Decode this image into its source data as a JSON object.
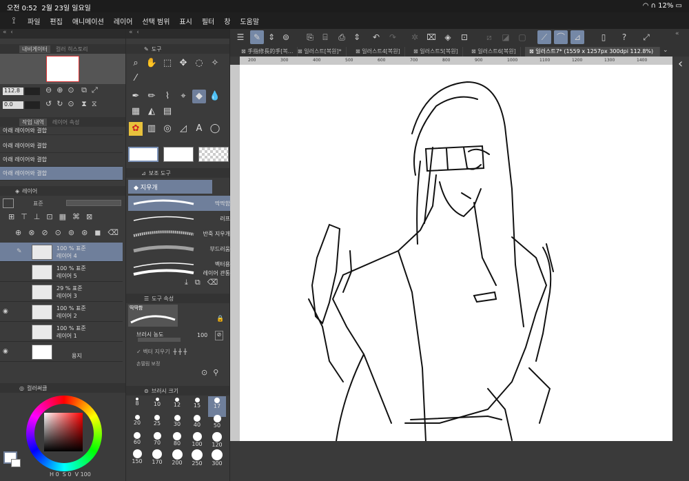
{
  "status_bar": {
    "time": "오전 0:52",
    "date": "2월 23일 일요일",
    "battery": "12%"
  },
  "menu": {
    "items": [
      "파일",
      "편집",
      "애니메이션",
      "레이어",
      "선택 범위",
      "표시",
      "필터",
      "창",
      "도움말"
    ]
  },
  "navigator": {
    "tab_label": "내비게이터",
    "tab2_label": "컬러 히스토리",
    "zoom": "112.8",
    "rotation": "0.0"
  },
  "history": {
    "tab_label": "작업 내역",
    "tab2_label": "레이어 속성",
    "items": [
      "아래 레이어와 결합",
      "아래 레이어와 결합",
      "아래 레이어와 결합",
      "아래 레이어와 결합"
    ]
  },
  "layers": {
    "tab_label": "레이어",
    "blend_label": "표준",
    "items": [
      {
        "pct": "100 % 표준",
        "name": "레이어 4",
        "selected": true,
        "visible": false
      },
      {
        "pct": "100 % 표준",
        "name": "레이어 5",
        "selected": false,
        "visible": false
      },
      {
        "pct": "29 % 표준",
        "name": "레이어 3",
        "selected": false,
        "visible": false
      },
      {
        "pct": "100 % 표준",
        "name": "레이어 2",
        "selected": false,
        "visible": true
      },
      {
        "pct": "100 % 표준",
        "name": "레이어 1",
        "selected": false,
        "visible": false
      },
      {
        "pct": "",
        "name": "용지",
        "selected": false,
        "visible": true
      }
    ]
  },
  "color_circle": {
    "tab_label": "컬러써클",
    "h": "0",
    "s": "0",
    "v": "100",
    "h_label": "H",
    "s_label": "S",
    "v_label": "V"
  },
  "tools": {
    "tab_label": "도구"
  },
  "sub_tool": {
    "tab_label": "보조 도구",
    "group": "지우개",
    "items": [
      "딱딱함",
      "러프",
      "반죽 지우개",
      "부드러움",
      "벡터용",
      "레이어 관통"
    ]
  },
  "tool_property": {
    "tab_label": "도구 속성",
    "preset": "딱딱함",
    "brush_density_label": "브러시 농도",
    "brush_density": "100",
    "vector_erase_label": "벡터 지우기",
    "anti_alias_label": "손떨림 보정"
  },
  "brush_size": {
    "tab_label": "브러시 크기",
    "sizes": [
      "8",
      "10",
      "12",
      "15",
      "17",
      "20",
      "25",
      "30",
      "40",
      "50",
      "60",
      "70",
      "80",
      "100",
      "120",
      "150",
      "170",
      "200",
      "250",
      "300"
    ]
  },
  "doc_tabs": [
    "手指修長的手[복...",
    "일러스트[복원]*",
    "일러스트4[복원]",
    "일러스트5[복원]",
    "일러스트6[복원]",
    "일러스트7* (1559 x 1257px 300dpi 112.8%)"
  ],
  "ruler": {
    "h_ticks": [
      "200",
      "300",
      "400",
      "500",
      "600",
      "700",
      "800",
      "900",
      "1000",
      "1100",
      "1200",
      "1300",
      "1400"
    ]
  },
  "colors": {
    "accent": "#6f7f9b",
    "panel": "#3b3b3b",
    "canvas_bg": "#3a3a3a"
  }
}
